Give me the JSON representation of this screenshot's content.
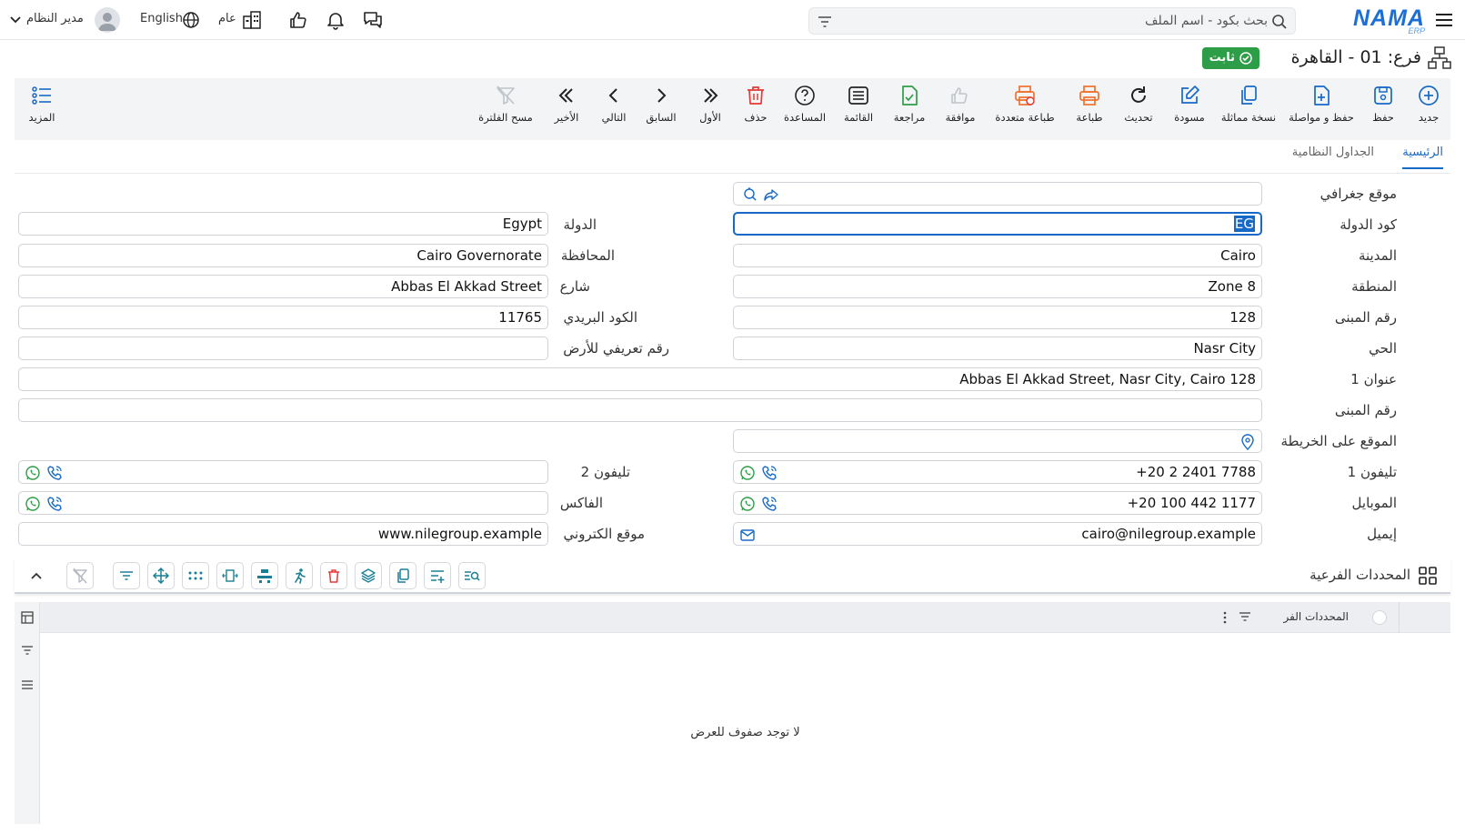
{
  "header": {
    "logo_main": "NAMA",
    "logo_sub": "ERP",
    "search_placeholder": "بحث بكود - اسم الملف",
    "scope_label": "عام",
    "language_label": "English",
    "user_label": "مدير النظام"
  },
  "title": {
    "text": "فرع: 01 - القاهرة",
    "status": "ثابت"
  },
  "toolbar": {
    "items": [
      {
        "label": "جديد"
      },
      {
        "label": "حفظ"
      },
      {
        "label": "حفظ و مواصلة"
      },
      {
        "label": "نسخة مماثلة"
      },
      {
        "label": "مسودة"
      },
      {
        "label": "تحديث"
      },
      {
        "label": "طباعة"
      },
      {
        "label": "طباعة متعددة"
      },
      {
        "label": "موافقة"
      },
      {
        "label": "مراجعة"
      },
      {
        "label": "القائمة"
      },
      {
        "label": "المساعدة"
      },
      {
        "label": "حذف"
      },
      {
        "label": "الأول"
      },
      {
        "label": "السابق"
      },
      {
        "label": "التالي"
      },
      {
        "label": "الأخير"
      },
      {
        "label": "مسح الفلترة"
      }
    ],
    "more_label": "المزيد"
  },
  "tabs": [
    {
      "label": "الرئيسية"
    },
    {
      "label": "الجداول النظامية"
    }
  ],
  "form": {
    "geo_location": {
      "label": "موقع جغرافي",
      "value": ""
    },
    "country_code": {
      "label": "كود الدولة",
      "value": "EG"
    },
    "country": {
      "label": "الدولة",
      "value": "Egypt"
    },
    "city": {
      "label": "المدينة",
      "value": "Cairo"
    },
    "governorate": {
      "label": "المحافظة",
      "value": "Cairo Governorate"
    },
    "region": {
      "label": "المنطقة",
      "value": "Zone 8"
    },
    "street": {
      "label": "شارع",
      "value": "Abbas El Akkad Street"
    },
    "building_no": {
      "label": "رقم المبنى",
      "value": "128"
    },
    "postal_code": {
      "label": "الكود البريدي",
      "value": "11765"
    },
    "district": {
      "label": "الحي",
      "value": "Nasr City"
    },
    "land_id": {
      "label": "رقم تعريفي للأرض",
      "value": ""
    },
    "address1": {
      "label": "عنوان 1",
      "value": "Abbas El Akkad Street, Nasr City, Cairo 128"
    },
    "building_no2": {
      "label": "رقم المبنى",
      "value": ""
    },
    "map_location": {
      "label": "الموقع على الخريطة",
      "value": ""
    },
    "phone1": {
      "label": "تليفون 1",
      "value": "+20 2 2401 7788"
    },
    "phone2": {
      "label": "تليفون 2",
      "value": ""
    },
    "mobile": {
      "label": "الموبايل",
      "value": "+20 100 442 1177"
    },
    "fax": {
      "label": "الفاكس",
      "value": ""
    },
    "email": {
      "label": "إيميل",
      "value": "cairo@nilegroup.example"
    },
    "website": {
      "label": "موقع الكتروني",
      "value": "www.nilegroup.example"
    }
  },
  "sub_grid": {
    "title": "المحددات الفرعية",
    "column_title": "المحددات الفر",
    "empty_message": "لا توجد صفوف للعرض"
  },
  "colors": {
    "accent": "#1769c7",
    "status_green": "#2e9d47",
    "danger": "#e53935",
    "print_orange": "#f0712c"
  }
}
